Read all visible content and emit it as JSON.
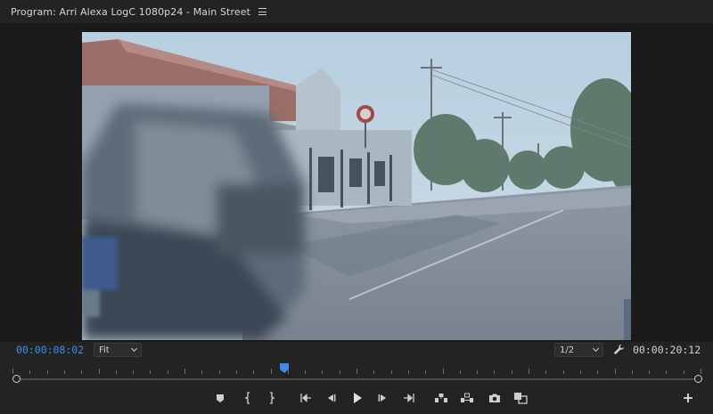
{
  "panel": {
    "title": "Program: Arri Alexa LogC 1080p24 - Main Street"
  },
  "viewer": {
    "current_timecode": "00:00:08:02",
    "duration_timecode": "00:00:20:12",
    "zoom_select": "Fit",
    "resolution_select": "1/2",
    "playhead_progress": 0.395
  },
  "colors": {
    "accent_timecode": "#3b8dea",
    "panel_bg": "#232323",
    "viewer_bg": "#1a1a1a"
  },
  "transport": {
    "buttons": [
      "add-marker-icon",
      "mark-in-icon",
      "mark-out-icon",
      "go-to-in-icon",
      "step-back-icon",
      "play-icon",
      "step-forward-icon",
      "go-to-out-icon",
      "lift-icon",
      "extract-icon",
      "export-frame-icon",
      "comparison-view-icon",
      "button-editor-icon"
    ]
  }
}
